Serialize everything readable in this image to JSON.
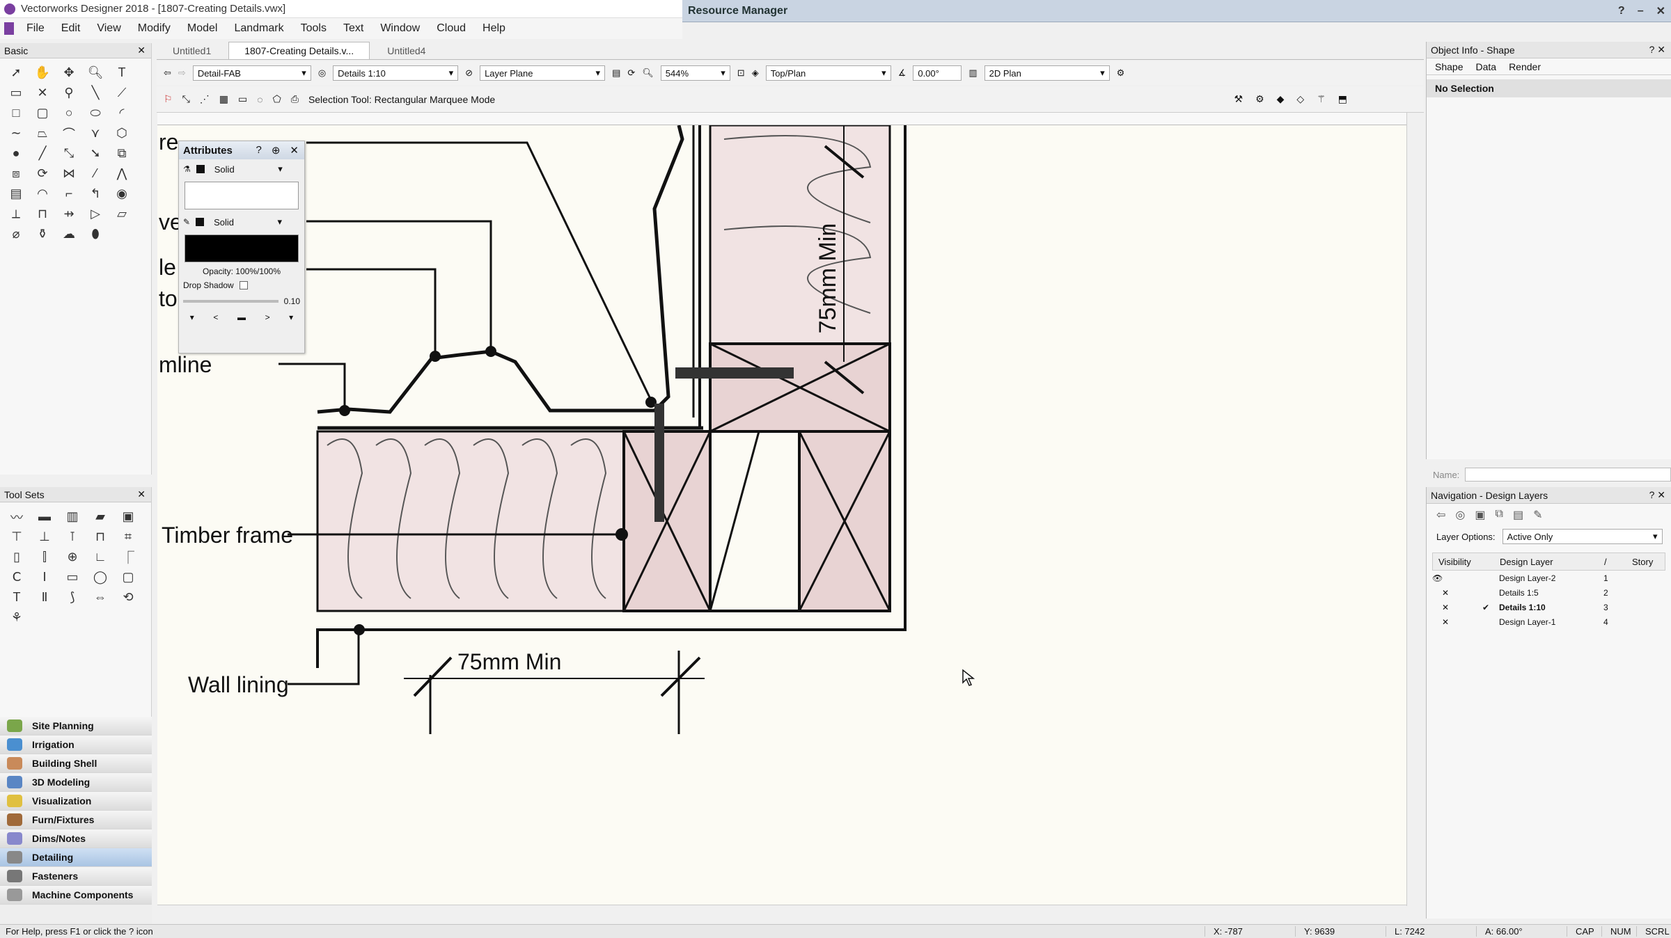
{
  "app": {
    "title": "Vectorworks Designer 2018 - [1807-Creating Details.vwx]"
  },
  "resource_manager": {
    "title": "Resource Manager"
  },
  "menu": [
    "File",
    "Edit",
    "View",
    "Modify",
    "Model",
    "Landmark",
    "Tools",
    "Text",
    "Window",
    "Cloud",
    "Help"
  ],
  "basic_palette": {
    "title": "Basic"
  },
  "tool_sets": {
    "title": "Tool Sets"
  },
  "toolset_list": [
    "Site Planning",
    "Irrigation",
    "Building Shell",
    "3D Modeling",
    "Visualization",
    "Furn/Fixtures",
    "Dims/Notes",
    "Detailing",
    "Fasteners",
    "Machine Components"
  ],
  "toolset_selected": "Detailing",
  "tabs": [
    "Untitled1",
    "1807-Creating Details.v...",
    "Untitled4"
  ],
  "active_tab": "1807-Creating Details.v...",
  "viewbar": {
    "class": "Detail-FAB",
    "layer": "Details 1:10",
    "plane": "Layer Plane",
    "zoom": "544%",
    "view": "Top/Plan",
    "angle": "0.00°",
    "render": "2D Plan"
  },
  "modebar": {
    "status": "Selection Tool: Rectangular Marquee Mode"
  },
  "attributes": {
    "title": "Attributes",
    "fill_style": "Solid",
    "pen_style": "Solid",
    "opacity": "Opacity: 100%/100%",
    "drop_shadow": "Drop Shadow",
    "line_weight": "0.10"
  },
  "drawing": {
    "label_75_vertical": "75mm Min",
    "label_75_horizontal": "75mm Min",
    "label_timber_frame": "Timber frame",
    "label_wall_lining": "Wall lining",
    "label_mline": "mline",
    "label_le": "le",
    "label_to": "to",
    "label_ve": "ve",
    "label_re": "re"
  },
  "object_info": {
    "title": "Object Info - Shape",
    "tabs": [
      "Shape",
      "Data",
      "Render"
    ],
    "selection": "No Selection",
    "name_label": "Name:"
  },
  "navigation": {
    "title": "Navigation - Design Layers",
    "layer_options_label": "Layer Options:",
    "layer_options_value": "Active Only",
    "col_visibility": "Visibility",
    "col_design_layer": "Design Layer",
    "col_story": "Story",
    "layers": [
      {
        "name": "Design Layer-2",
        "num": "1",
        "active": false
      },
      {
        "name": "Details 1:5",
        "num": "2",
        "active": false
      },
      {
        "name": "Details 1:10",
        "num": "3",
        "active": true
      },
      {
        "name": "Design Layer-1",
        "num": "4",
        "active": false
      }
    ]
  },
  "status": {
    "help": "For Help, press F1 or click the ? icon",
    "x": "X: -787",
    "y": "Y: 9639",
    "l": "L: 7242",
    "a": "A: 66.00°",
    "caps": "CAP",
    "num": "NUM",
    "scrl": "SCRL"
  }
}
